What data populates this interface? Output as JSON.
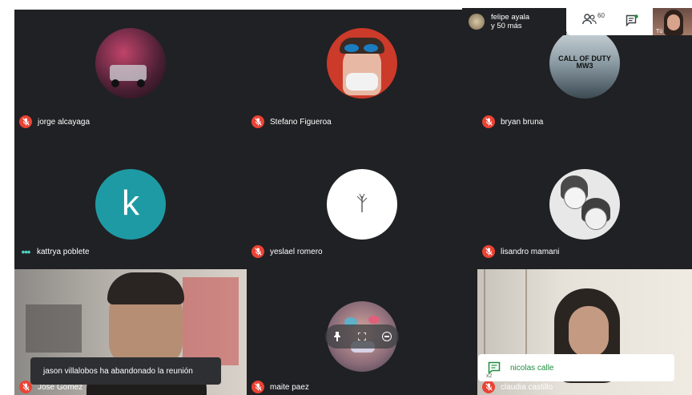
{
  "participants": [
    {
      "name": "jorge alcayaga",
      "mic": "muted"
    },
    {
      "name": "Stefano Figueroa",
      "mic": "muted"
    },
    {
      "name": "bryan bruna",
      "mic": "muted"
    },
    {
      "name": "kattrya poblete",
      "mic": "speaking",
      "initial": "k"
    },
    {
      "name": "yeslael romero",
      "mic": "muted"
    },
    {
      "name": "lisandro mamani",
      "mic": "muted"
    },
    {
      "name": "Jose Gomez",
      "mic": "muted"
    },
    {
      "name": "maite paez",
      "mic": "muted"
    },
    {
      "name": "claudia castillo",
      "mic": "muted"
    }
  ],
  "topbar": {
    "presenter_line1": "felipe ayala",
    "presenter_line2": "y 50 más",
    "people_count": "60"
  },
  "self_view_label": "Tú",
  "avatar_texts": {
    "cod_line1": "CALL OF DUTY",
    "cod_line2": "MW3"
  },
  "toast": {
    "text": "jason villalobos ha abandonado la reunión"
  },
  "chat_notification": {
    "sender": "nicolas calle",
    "badge": "x2"
  },
  "colors": {
    "background": "#202124",
    "mic_muted": "#ea4335",
    "accent_teal": "#1e9aa4",
    "chat_green": "#1e8e3e"
  }
}
